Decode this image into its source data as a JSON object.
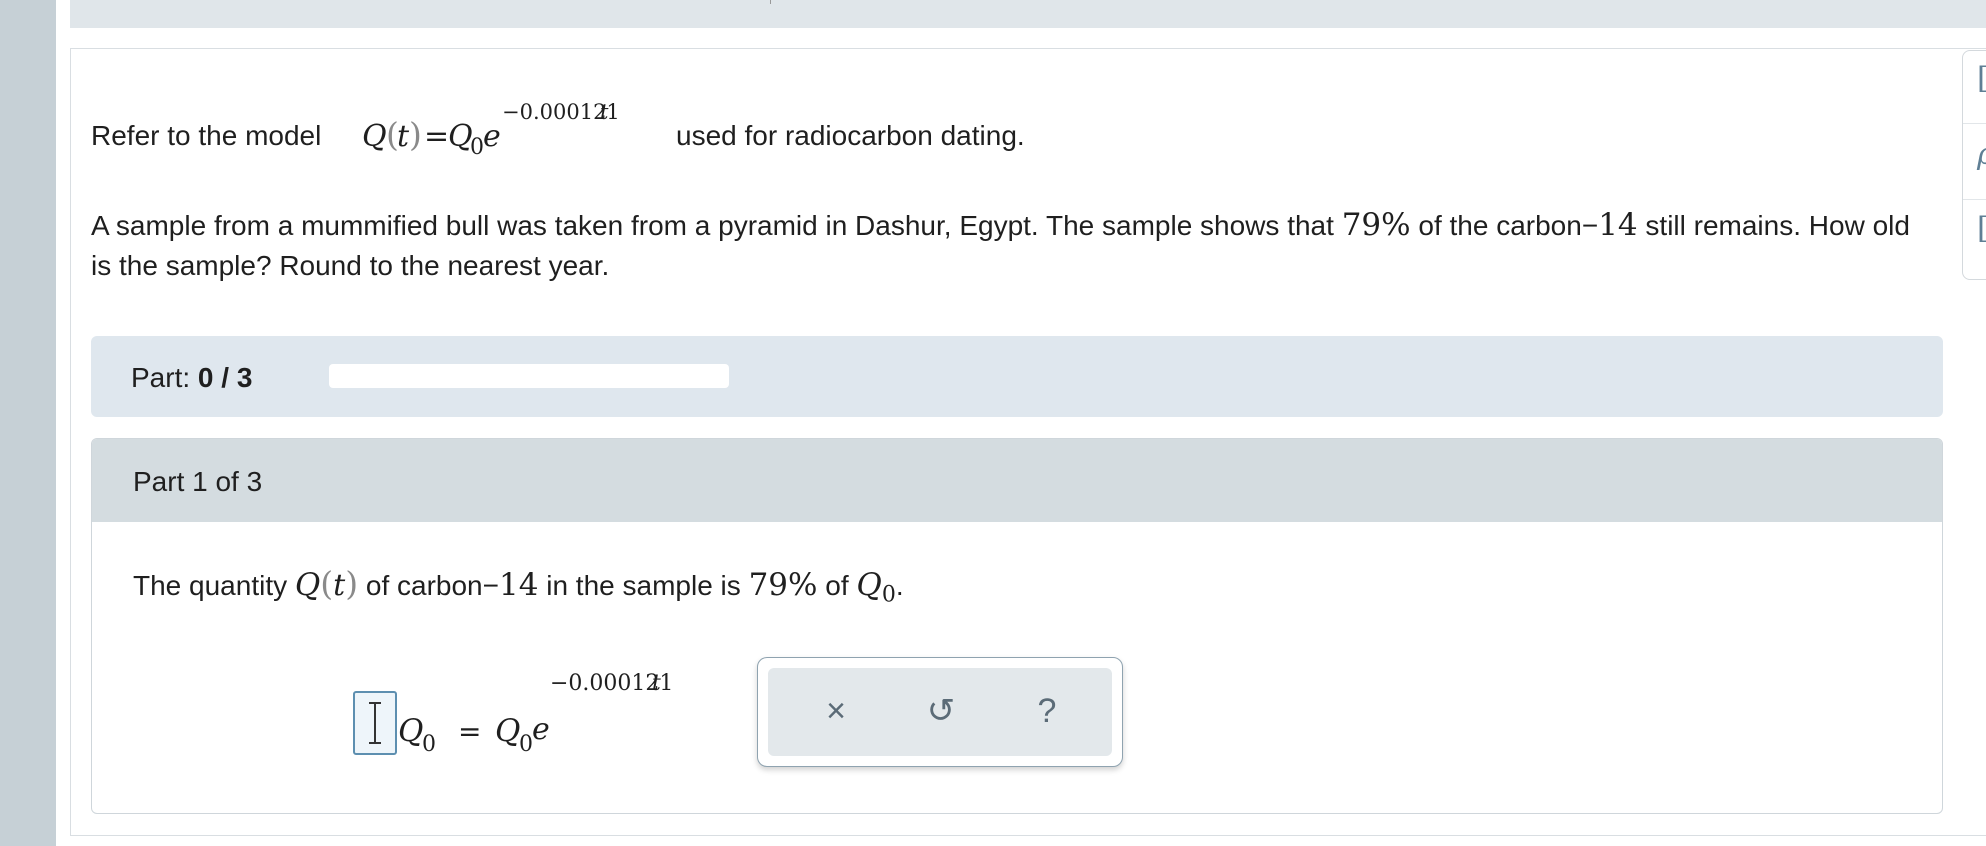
{
  "question": {
    "intro_before": "Refer to the model",
    "intro_after": "used for radiocarbon dating.",
    "model": {
      "Q": "Q",
      "t": "t",
      "Q0_base": "Q",
      "sub0": "0",
      "e": "e",
      "exponent": "−0.000121",
      "exp_var": "t"
    },
    "paragraph": {
      "p1": "A sample from a mummified bull was taken from a pyramid in Dashur, Egypt. The sample shows that ",
      "pct": "79%",
      "p2": " of the carbon",
      "dash": "−",
      "num14": "14",
      "p3": " still remains. How old is the sample? Round to the nearest year."
    }
  },
  "progress": {
    "label": "Part:",
    "value": "0 / 3",
    "fraction": 0.0
  },
  "part": {
    "header": "Part 1 of 3",
    "statement": {
      "s1": "The quantity ",
      "s2": " of carbon",
      "dash": "−",
      "num14": "14",
      "s3": " in the sample is ",
      "pct": "79%",
      "s4": " of ",
      "period": "."
    },
    "equation": {
      "exponent": "−0.000121",
      "exp_var": "t",
      "equals": "="
    }
  },
  "toolbox": {
    "clear_icon": "close-icon",
    "undo_icon": "undo-icon",
    "help_icon": "help-icon",
    "clear_glyph": "×",
    "undo_glyph": "↺",
    "help_glyph": "?"
  },
  "right_tools": {
    "glyph1": "[",
    "glyph2": "ρ",
    "glyph3": "["
  }
}
